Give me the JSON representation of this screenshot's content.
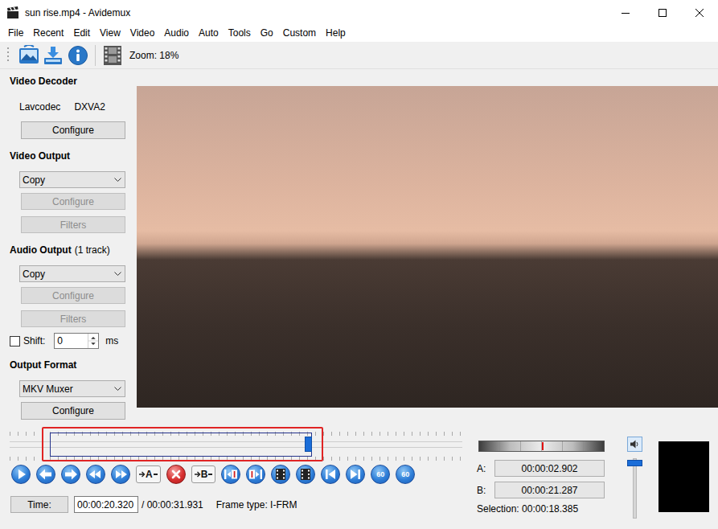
{
  "window": {
    "title": "sun rise.mp4 - Avidemux"
  },
  "menu": [
    "File",
    "Recent",
    "Edit",
    "View",
    "Video",
    "Audio",
    "Auto",
    "Tools",
    "Go",
    "Custom",
    "Help"
  ],
  "toolbar": {
    "zoom": "Zoom: 18%"
  },
  "video_decoder": {
    "heading": "Video Decoder",
    "decoder": "Lavcodec",
    "acceleration": "DXVA2",
    "configure": {
      "label": "Configure",
      "disabled": false
    }
  },
  "video_output": {
    "heading": "Video Output",
    "codec": "Copy",
    "configure": {
      "label": "Configure",
      "disabled": true
    },
    "filters": {
      "label": "Filters",
      "disabled": true
    }
  },
  "audio_output": {
    "heading": "Audio Output",
    "tracks": "(1 track)",
    "codec": "Copy",
    "configure": {
      "label": "Configure",
      "disabled": true
    },
    "filters": {
      "label": "Filters",
      "disabled": true
    },
    "shift": {
      "label": "Shift:",
      "checked": false,
      "value": "0",
      "unit": "ms"
    }
  },
  "output_format": {
    "heading": "Output Format",
    "format": "MKV Muxer",
    "configure": {
      "label": "Configure",
      "disabled": false
    }
  },
  "timeline": {
    "level": 0.66,
    "selection_start": 0.089,
    "selection_end": 0.668
  },
  "controls": [
    {
      "kind": "play"
    },
    {
      "kind": "previous-frame"
    },
    {
      "kind": "next-frame"
    },
    {
      "kind": "rewind"
    },
    {
      "kind": "fast-forward"
    },
    {
      "kind": "marker",
      "text": "A"
    },
    {
      "kind": "delete"
    },
    {
      "kind": "marker",
      "text": "B"
    },
    {
      "kind": "previous-keyframe"
    },
    {
      "kind": "next-keyframe"
    },
    {
      "kind": "previous-black"
    },
    {
      "kind": "next-black"
    },
    {
      "kind": "first-frame"
    },
    {
      "kind": "last-frame"
    },
    {
      "kind": "jump",
      "text": "60"
    },
    {
      "kind": "jump",
      "text": "60"
    }
  ],
  "time": {
    "button": "Time:",
    "value": "00:00:20.320",
    "total": "/ 00:00:31.931",
    "frame_type": "Frame type: I-FRM"
  },
  "audio_meter": {
    "level": 0.5
  },
  "markers": {
    "a_label": "A:",
    "a": "00:00:02.902",
    "b_label": "B:",
    "b": "00:00:21.287",
    "selection": "Selection: 00:00:18.385"
  },
  "volume": {
    "level": 0.93
  }
}
